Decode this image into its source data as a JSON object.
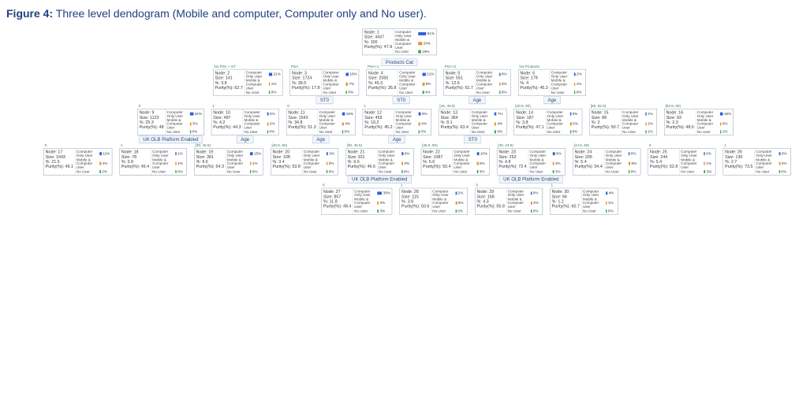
{
  "caption_label": "Figure 4:",
  "caption_text": " Three level dendogram (Mobile and computer, Computer only and No user).",
  "legend_labels": {
    "cou": "Computer Only User",
    "mcu": "Mobile & Computer User",
    "nu": "No User"
  },
  "chart_data": {
    "type": "tree",
    "title": "Three level dendogram (Mobile and computer, Computer only and No user)",
    "categories": [
      "Computer Only User",
      "Mobile & Computer User",
      "No User"
    ],
    "root": {
      "id": "N1",
      "node_no": 1,
      "size": 4437,
      "pct": 100,
      "purity": 47.9,
      "dist": {
        "cou": 61,
        "mcu": 24,
        "nu": 15
      }
    },
    "splits": [
      {
        "var": "Products Cat",
        "children": [
          "N2",
          "N3",
          "N4",
          "N5",
          "N6"
        ]
      }
    ],
    "nodes": {
      "N2": {
        "label": "No PSA + ST",
        "node_no": 2,
        "size": 141,
        "pct": 3.8,
        "purity": 62.7,
        "dist": {
          "cou": 21,
          "mcu": 1,
          "nu": 0
        }
      },
      "N3": {
        "label": "PSA",
        "node_no": 3,
        "size": 1724,
        "pct": 39.5,
        "purity": 17.8,
        "dist": {
          "cou": 16,
          "mcu": 7,
          "nu": 0
        },
        "split": "ST0"
      },
      "N4": {
        "label": "PSA+1",
        "node_no": 4,
        "size": 2050,
        "pct": 45.3,
        "purity": 35.8,
        "dist": {
          "cou": 21,
          "mcu": 9,
          "nu": 4
        },
        "split": "ST0"
      },
      "N5": {
        "label": "PSA+2",
        "node_no": 5,
        "size": 551,
        "pct": 12.6,
        "purity": 61.7,
        "dist": {
          "cou": 0,
          "mcu": 0,
          "nu": 0
        },
        "split": "Age"
      },
      "N6": {
        "label": "No Products",
        "node_no": 6,
        "size": 179,
        "pct": 4.0,
        "purity": 45.3,
        "dist": {
          "cou": 2,
          "mcu": 1,
          "nu": 0
        },
        "split": "Age"
      },
      "N9": {
        "parent": "N3",
        "label": "0",
        "node_no": 9,
        "size": 1123,
        "pct": 25.3,
        "purity": 48.0,
        "dist": {
          "cou": 22,
          "mcu": 3,
          "nu": 0
        },
        "split": "UK OLB Platform Enabled"
      },
      "N10": {
        "parent": "N3",
        "label": "1",
        "node_no": 10,
        "size": 487,
        "pct": 4.2,
        "purity": 44.3,
        "dist": {
          "cou": 2,
          "mcu": 2,
          "nu": 0
        },
        "split": "Age"
      },
      "N11": {
        "parent": "N4",
        "label": "0",
        "node_no": 11,
        "size": 1543,
        "pct": 34.8,
        "purity": 51.3,
        "dist": {
          "cou": 15,
          "mcu": 4,
          "nu": 0
        },
        "split": "Age"
      },
      "N12": {
        "parent": "N4",
        "label": "1",
        "node_no": 12,
        "size": 455,
        "pct": 10.2,
        "purity": 45.2,
        "dist": {
          "cou": 9,
          "mcu": 4,
          "nu": 0
        },
        "split": "Age"
      },
      "N13": {
        "parent": "N5",
        "label": "[16, 40.5)",
        "node_no": 13,
        "size": 364,
        "pct": 8.1,
        "purity": 63.4,
        "dist": {
          "cou": 7,
          "mcu": 4,
          "nu": 5
        },
        "split": "ST0"
      },
      "N14": {
        "parent": "N5",
        "label": "[40.5, 60)",
        "node_no": 14,
        "size": 187,
        "pct": 3.8,
        "purity": 47.1,
        "dist": {
          "cou": 0,
          "mcu": 5,
          "nu": 0
        }
      },
      "N15": {
        "parent": "N6",
        "label": "[50, 52.5)",
        "node_no": 15,
        "size": 88,
        "pct": 2.0,
        "purity": 50.7,
        "dist": {
          "cou": 1,
          "mcu": 1,
          "nu": 1
        }
      },
      "N16": {
        "parent": "N6",
        "label": "[52.5, 60)",
        "node_no": 16,
        "size": 93,
        "pct": 2.3,
        "purity": 48.5,
        "dist": {
          "cou": 15,
          "mcu": 0,
          "nu": 1
        }
      },
      "N17": {
        "parent": "N9",
        "label": "0",
        "node_no": 17,
        "size": 1043,
        "pct": 21.5,
        "purity": 49.1,
        "dist": {
          "cou": 11,
          "mcu": 4,
          "nu": 2
        }
      },
      "N18": {
        "parent": "N9",
        "label": "1",
        "node_no": 18,
        "size": 78,
        "pct": 3.8,
        "purity": 45.4,
        "dist": {
          "cou": 1,
          "mcu": 1,
          "nu": 0
        }
      },
      "N19": {
        "parent": "N10",
        "label": "[30, 45.5)",
        "node_no": 19,
        "size": 381,
        "pct": 8.6,
        "purity": 64.3,
        "dist": {
          "cou": 15,
          "mcu": 1,
          "nu": 0
        }
      },
      "N20": {
        "parent": "N10",
        "label": "[45.5, 60)",
        "node_no": 20,
        "size": 108,
        "pct": 3.4,
        "purity": 53.8,
        "dist": {
          "cou": 3,
          "mcu": 0,
          "nu": 0
        }
      },
      "N21": {
        "parent": "N11",
        "label": "[30, 45.5)",
        "node_no": 21,
        "size": 911,
        "pct": 6.6,
        "purity": 46.6,
        "dist": {
          "cou": 6,
          "mcu": 3,
          "nu": 0
        },
        "split": "UK OLB Platform Enabled"
      },
      "N22": {
        "parent": "N11",
        "label": "[45.5, 60)",
        "node_no": 22,
        "size": 1087,
        "pct": 5.6,
        "purity": 50.4,
        "dist": {
          "cou": 10,
          "mcu": 6,
          "nu": 3
        }
      },
      "N23": {
        "parent": "N12",
        "label": "[30, 44.5)",
        "node_no": 23,
        "size": 252,
        "pct": 4.8,
        "purity": 72.4,
        "dist": {
          "cou": 9,
          "mcu": 3,
          "nu": 3
        },
        "split": "UK OLB Platform Enabled"
      },
      "N24": {
        "parent": "N12",
        "label": "[44.5, 60)",
        "node_no": 24,
        "size": 205,
        "pct": 5.4,
        "purity": 54.4,
        "dist": {
          "cou": 0,
          "mcu": 6,
          "nu": 0
        }
      },
      "N25": {
        "parent": "N13",
        "label": "0",
        "node_no": 25,
        "size": 244,
        "pct": 5.4,
        "purity": 52.8,
        "dist": {
          "cou": 0,
          "mcu": 1,
          "nu": 3
        }
      },
      "N26": {
        "parent": "N13",
        "label": "1",
        "node_no": 26,
        "size": 130,
        "pct": 2.7,
        "purity": 73.5,
        "dist": {
          "cou": 3,
          "mcu": 2,
          "nu": 0
        }
      },
      "N27": {
        "parent": "N21",
        "label": "0",
        "node_no": 27,
        "size": 857,
        "pct": 11.8,
        "purity": 48.4,
        "dist": {
          "cou": 30,
          "mcu": 2,
          "nu": 3
        }
      },
      "N28": {
        "parent": "N21",
        "label": "1",
        "node_no": 28,
        "size": 115,
        "pct": 3.8,
        "purity": 50.6,
        "dist": {
          "cou": 2,
          "mcu": 5,
          "nu": 0
        }
      },
      "N29": {
        "parent": "N23",
        "label": "0",
        "node_no": 29,
        "size": 168,
        "pct": 4.3,
        "purity": 55.8,
        "dist": {
          "cou": 0,
          "mcu": 2,
          "nu": 0
        }
      },
      "N30": {
        "parent": "N23",
        "label": "1",
        "node_no": 30,
        "size": 84,
        "pct": 1.2,
        "purity": 60.7,
        "dist": {
          "cou": 4,
          "mcu": 1,
          "nu": 0
        }
      }
    }
  }
}
